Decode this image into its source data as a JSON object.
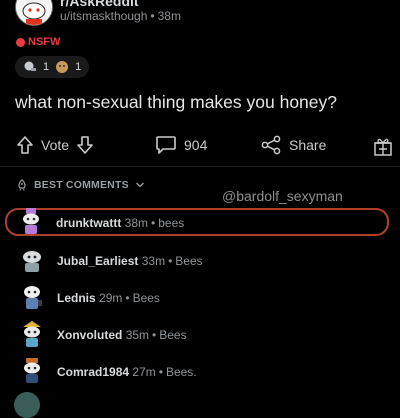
{
  "post": {
    "subreddit": "r/AskReddit",
    "username": "u/itsmaskthough",
    "age": "38m",
    "nsfw_label": "NSFW",
    "awards": [
      {
        "icon": "silver-award-icon",
        "count": "1"
      },
      {
        "icon": "doge-award-icon",
        "count": "1"
      }
    ],
    "title": "what non-sexual thing makes you honey?"
  },
  "actions": {
    "vote_label": "Vote",
    "comments_count": "904",
    "share_label": "Share"
  },
  "comments_header": {
    "sort_label": "BEST COMMENTS"
  },
  "watermark": "@bardolf_sexyman",
  "comments": [
    {
      "user": "drunktwattt",
      "age": "38m",
      "text": "bees",
      "avatar_color": "#b57ad9",
      "highlighted": true
    },
    {
      "user": "Jubal_Earliest",
      "age": "33m",
      "text": "Bees",
      "avatar_color": "#8fa0a6",
      "highlighted": false
    },
    {
      "user": "Lednis",
      "age": "29m",
      "text": "Bees",
      "avatar_color": "#5c7fb5",
      "highlighted": false
    },
    {
      "user": "Xonvoluted",
      "age": "35m",
      "text": "Bees",
      "avatar_color": "#5ba7c9",
      "highlighted": false
    },
    {
      "user": "Comrad1984",
      "age": "27m",
      "text": "Bees.",
      "avatar_color": "#c46b2e",
      "highlighted": false
    }
  ],
  "colors": {
    "background": "#000000",
    "nsfw": "#ea3b43",
    "highlight_border": "#b0402a",
    "muted_text": "#8f9497"
  }
}
